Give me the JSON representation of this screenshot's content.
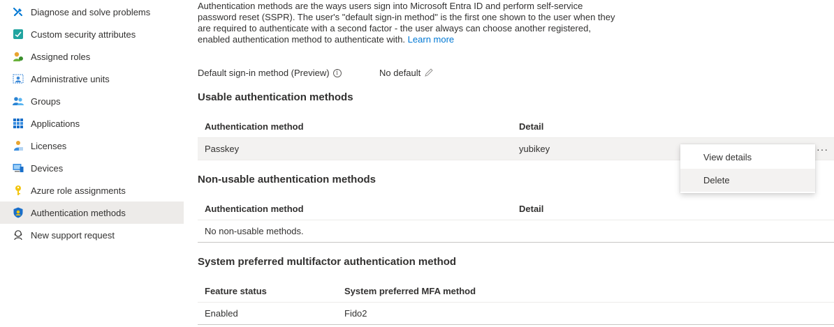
{
  "sidebar": {
    "items": [
      {
        "label": "Diagnose and solve problems",
        "icon": "wrench-icon"
      },
      {
        "label": "Custom security attributes",
        "icon": "attributes-icon"
      },
      {
        "label": "Assigned roles",
        "icon": "person-roles-icon"
      },
      {
        "label": "Administrative units",
        "icon": "admin-units-icon"
      },
      {
        "label": "Groups",
        "icon": "groups-icon"
      },
      {
        "label": "Applications",
        "icon": "apps-grid-icon"
      },
      {
        "label": "Licenses",
        "icon": "license-icon"
      },
      {
        "label": "Devices",
        "icon": "device-icon"
      },
      {
        "label": "Azure role assignments",
        "icon": "key-icon"
      },
      {
        "label": "Authentication methods",
        "icon": "shield-icon",
        "active": true
      },
      {
        "label": "New support request",
        "icon": "support-icon"
      }
    ]
  },
  "intro": {
    "text": "Authentication methods are the ways users sign into Microsoft Entra ID and perform self-service password reset (SSPR). The user's \"default sign-in method\" is the first one shown to the user when they are required to authenticate with a second factor - the user always can choose another registered, enabled authentication method to authenticate with.",
    "link": "Learn more"
  },
  "default_method": {
    "label": "Default sign-in method (Preview)",
    "info_glyph": "i",
    "value": "No default"
  },
  "usable": {
    "title": "Usable authentication methods",
    "col_method": "Authentication method",
    "col_detail": "Detail",
    "rows": [
      {
        "method": "Passkey",
        "detail": "yubikey"
      }
    ],
    "more_glyph": "···"
  },
  "non_usable": {
    "title": "Non-usable authentication methods",
    "col_method": "Authentication method",
    "col_detail": "Detail",
    "empty": "No non-usable methods."
  },
  "system_mfa": {
    "title": "System preferred multifactor authentication method",
    "col_status": "Feature status",
    "col_method": "System preferred MFA method",
    "rows": [
      {
        "status": "Enabled",
        "method": "Fido2"
      }
    ]
  },
  "context_menu": {
    "view_details": "View details",
    "delete": "Delete"
  },
  "colors": {
    "link": "#0078d4",
    "active_bg": "#edebe9",
    "selected_row": "#f3f2f1"
  }
}
